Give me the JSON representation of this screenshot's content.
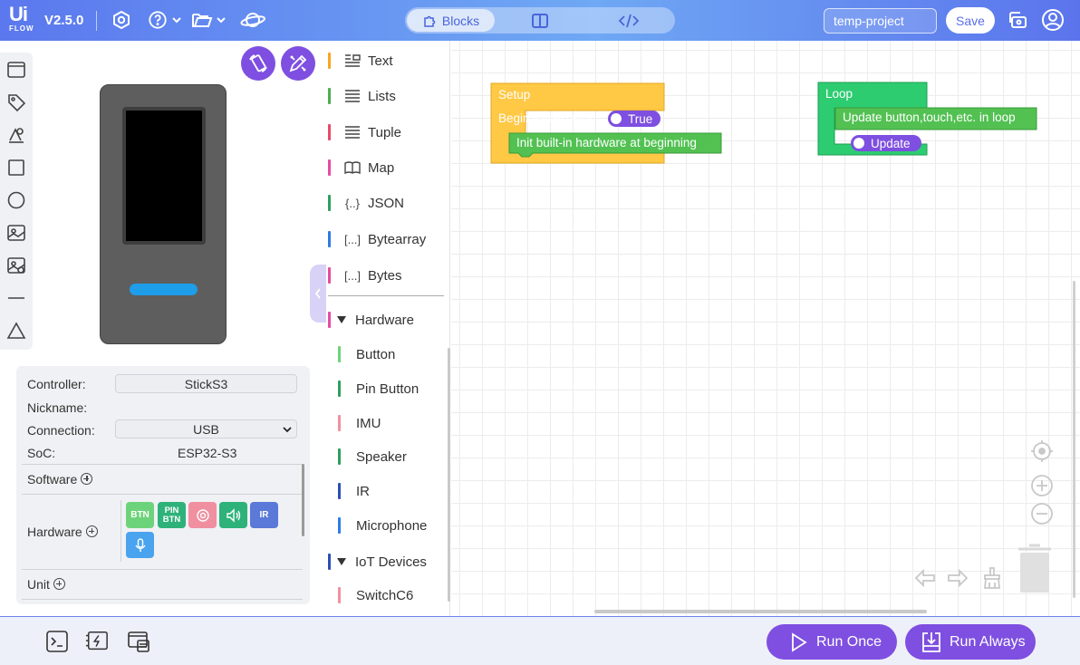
{
  "header": {
    "logo_top": "Ui",
    "logo_bottom": "FLOW",
    "version": "V2.5.0",
    "tabs": [
      {
        "label": "Blocks",
        "icon": "puzzle-icon",
        "active": true
      },
      {
        "label": "",
        "icon": "split-view-icon",
        "active": false
      },
      {
        "label": "",
        "icon": "code-icon",
        "active": false
      }
    ],
    "project_name": "temp-project",
    "save_label": "Save"
  },
  "device": {
    "controller_label": "Controller:",
    "controller_value": "StickS3",
    "nickname_label": "Nickname:",
    "connection_label": "Connection:",
    "connection_value": "USB",
    "soc_label": "SoC:",
    "soc_value": "ESP32-S3",
    "software_label": "Software",
    "hardware_label": "Hardware",
    "unit_label": "Unit",
    "hardware_chips": [
      {
        "label": "BTN",
        "color": "#6dd37a"
      },
      {
        "label": "PIN BTN",
        "color": "#2eb27a"
      },
      {
        "label": "",
        "icon": "imu-icon",
        "color": "#f08fa0"
      },
      {
        "label": "",
        "icon": "speaker-icon",
        "color": "#2eb27a"
      },
      {
        "label": "IR",
        "color": "#5a79d8"
      },
      {
        "label": "",
        "icon": "microphone-icon",
        "color": "#4aa3ee"
      }
    ]
  },
  "categories": [
    {
      "label": "Text",
      "icon": "≡",
      "color": "#f5a623"
    },
    {
      "label": "Lists",
      "icon": "☰",
      "color": "#4caf50"
    },
    {
      "label": "Tuple",
      "icon": "☰",
      "color": "#e84a6a"
    },
    {
      "label": "Map",
      "icon": "📖",
      "color": "#e84aa0"
    },
    {
      "label": "JSON",
      "icon": "{..}",
      "color": "#2e9e5e"
    },
    {
      "label": "Bytearray",
      "icon": "[...]",
      "color": "#2c7be5"
    },
    {
      "label": "Bytes",
      "icon": "[...]",
      "color": "#e84a9a"
    }
  ],
  "hardware_section": {
    "label": "Hardware",
    "items": [
      {
        "label": "Button",
        "color": "#6dd37a"
      },
      {
        "label": "Pin Button",
        "color": "#2e9e5e"
      },
      {
        "label": "IMU",
        "color": "#f08fa0"
      },
      {
        "label": "Speaker",
        "color": "#2e9e5e"
      },
      {
        "label": "IR",
        "color": "#2c4fb5"
      },
      {
        "label": "Microphone",
        "color": "#2c7be5"
      }
    ]
  },
  "iot_section": {
    "label": "IoT Devices",
    "items": [
      {
        "label": "SwitchC6",
        "color": "#f08fa0"
      }
    ]
  },
  "workspace": {
    "setup": {
      "title": "Setup",
      "begin_label": "Begin initialization",
      "begin_toggle": "True",
      "init_label": "Init built-in hardware at beginning",
      "color": "#ffc845",
      "inner_color": "#52c152"
    },
    "loop": {
      "title": "Loop",
      "update_label": "Update button,touch,etc. in loop",
      "update_toggle": "Update",
      "color": "#2ecc71",
      "inner_color": "#52c152"
    }
  },
  "footer": {
    "run_once_label": "Run Once",
    "run_always_label": "Run Always"
  },
  "colors": {
    "accent": "#7e4fe0",
    "header_start": "#5b78ee",
    "header_mid": "#6fa8f4"
  }
}
